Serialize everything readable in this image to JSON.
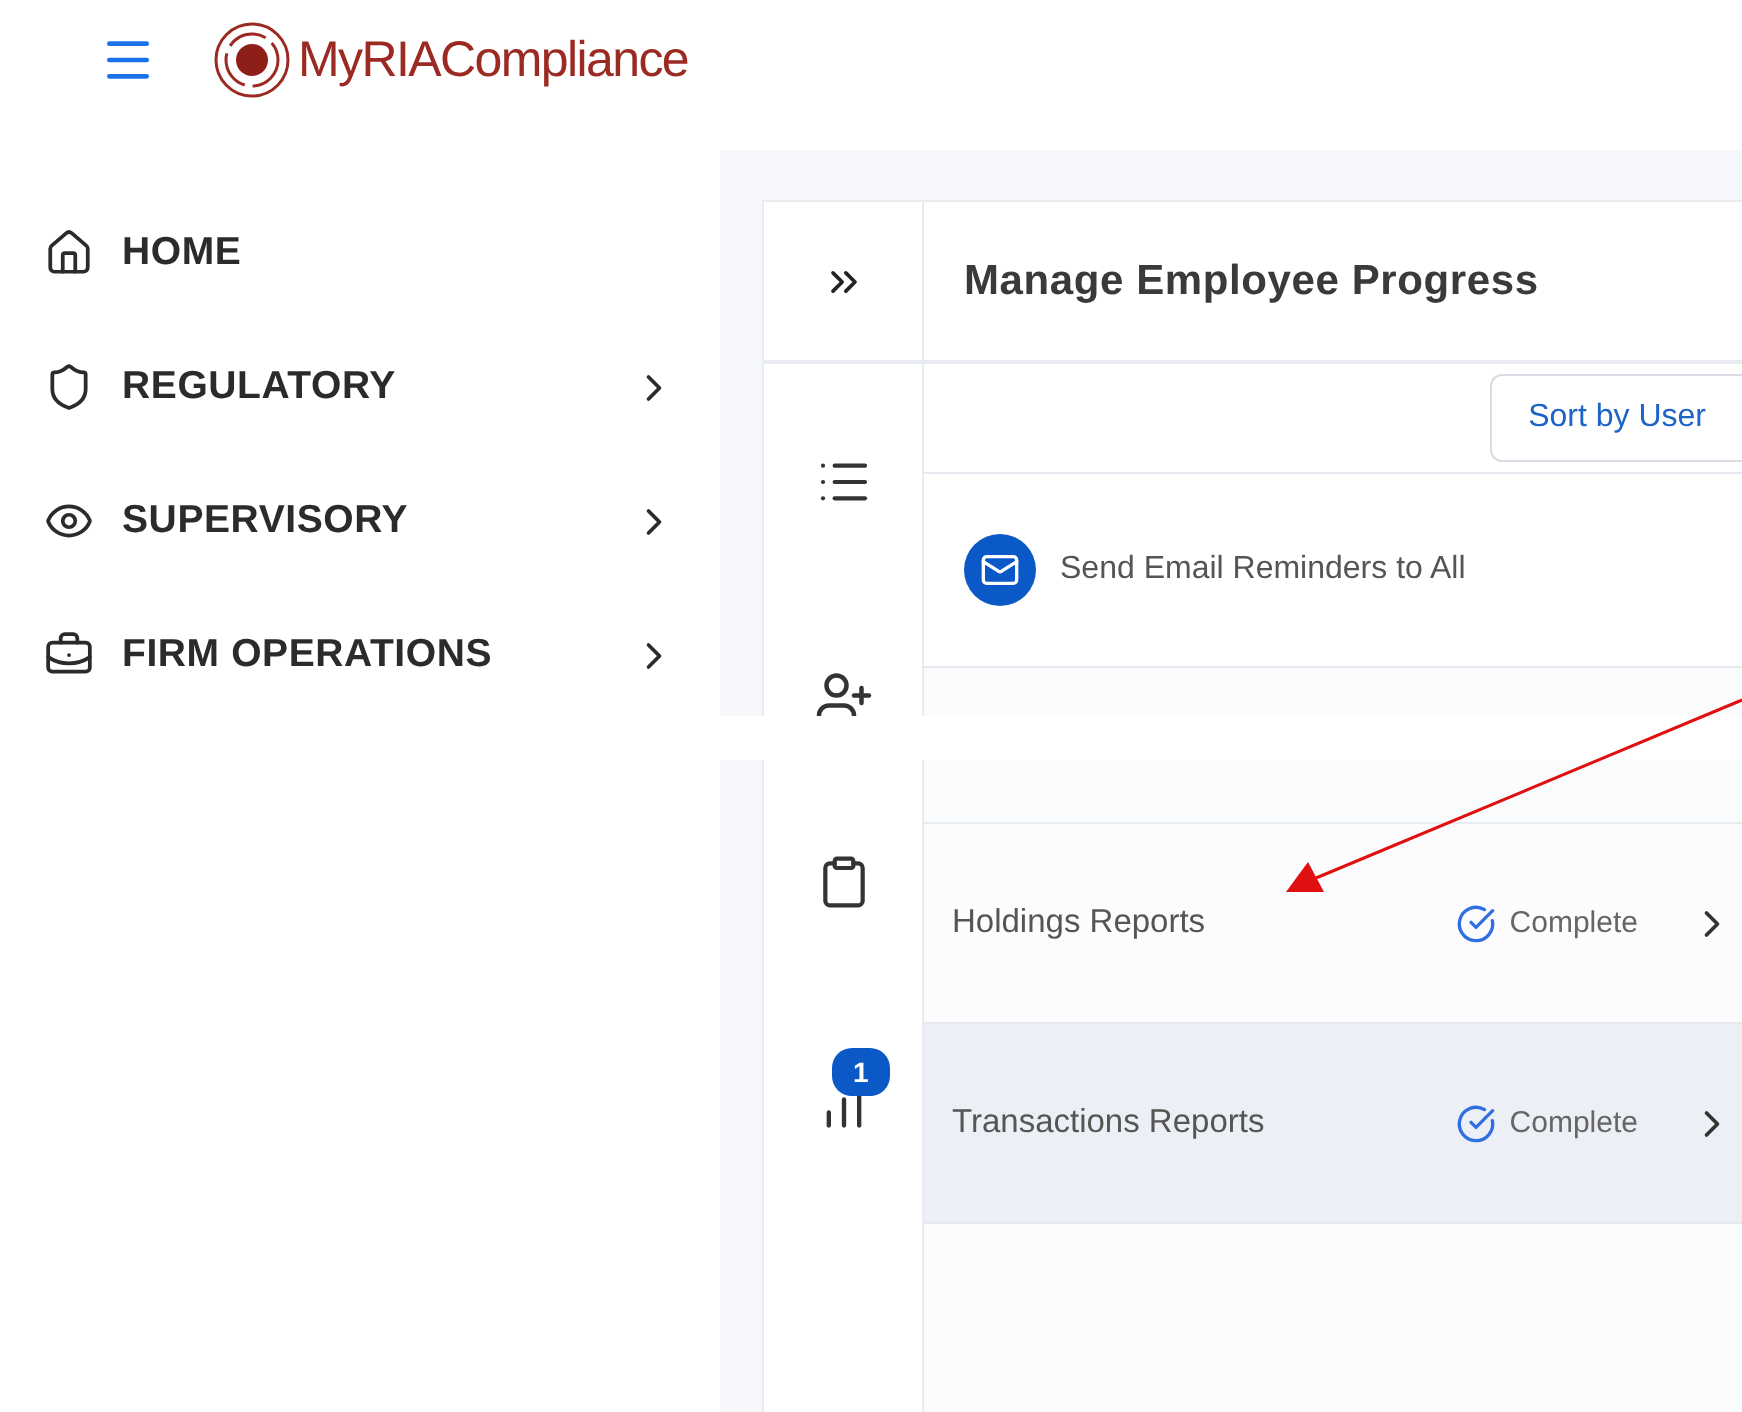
{
  "brand": {
    "name": "MyRIACompliance"
  },
  "sidebar": {
    "items": [
      {
        "label": "HOME",
        "expandable": false
      },
      {
        "label": "REGULATORY",
        "expandable": true
      },
      {
        "label": "SUPERVISORY",
        "expandable": true
      },
      {
        "label": "FIRM OPERATIONS",
        "expandable": true
      }
    ]
  },
  "panel": {
    "title": "Manage Employee Progress",
    "sort_button": "Sort by User",
    "email_action": "Send Email Reminders to All",
    "badge": "1"
  },
  "reports": [
    {
      "label": "Holdings Reports",
      "status": "Complete",
      "selected": false
    },
    {
      "label": "Transactions Reports",
      "status": "Complete",
      "selected": true
    }
  ]
}
